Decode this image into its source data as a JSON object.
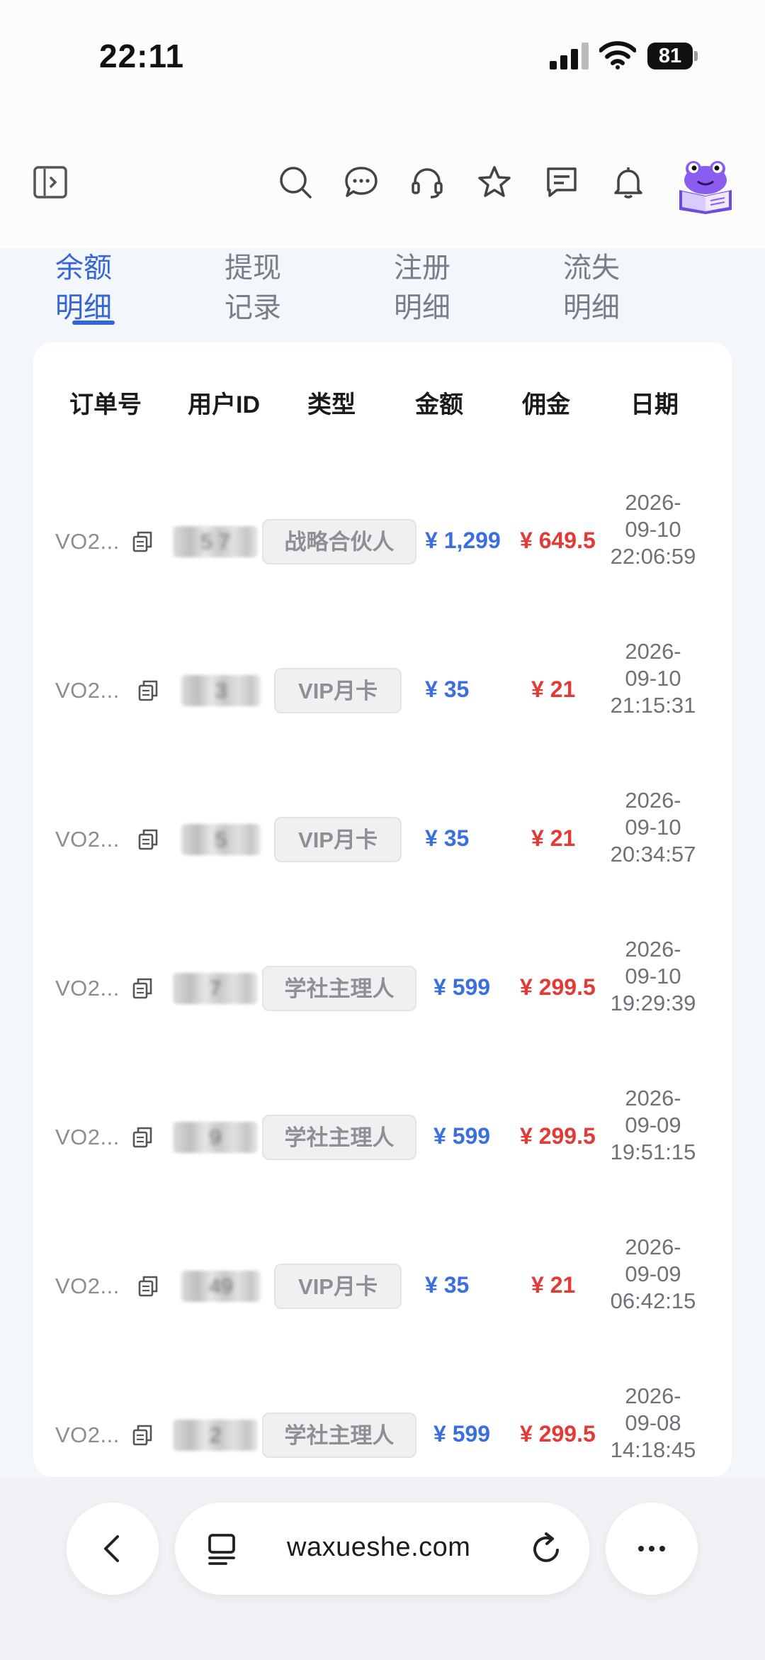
{
  "status": {
    "time": "22:11",
    "battery": "81"
  },
  "tabs": [
    {
      "line1": "余额",
      "line2": "明细",
      "active": true
    },
    {
      "line1": "提现",
      "line2": "记录",
      "active": false
    },
    {
      "line1": "注册",
      "line2": "明细",
      "active": false
    },
    {
      "line1": "流失",
      "line2": "明细",
      "active": false
    }
  ],
  "table": {
    "headers": [
      "订单号",
      "用户ID",
      "类型",
      "金额",
      "佣金",
      "日期"
    ],
    "rows": [
      {
        "order": "VO2...",
        "uid": "5 7",
        "type": "战略合伙人",
        "amount": "¥ 1,299",
        "commission": "¥ 649.5",
        "date1": "2026-",
        "date2": "09-10",
        "date3": "22:06:59"
      },
      {
        "order": "VO2...",
        "uid": "3",
        "type": "VIP月卡",
        "amount": "¥ 35",
        "commission": "¥ 21",
        "date1": "2026-",
        "date2": "09-10",
        "date3": "21:15:31"
      },
      {
        "order": "VO2...",
        "uid": "5",
        "type": "VIP月卡",
        "amount": "¥ 35",
        "commission": "¥ 21",
        "date1": "2026-",
        "date2": "09-10",
        "date3": "20:34:57"
      },
      {
        "order": "VO2...",
        "uid": "7",
        "type": "学社主理人",
        "amount": "¥ 599",
        "commission": "¥ 299.5",
        "date1": "2026-",
        "date2": "09-10",
        "date3": "19:29:39"
      },
      {
        "order": "VO2...",
        "uid": "9",
        "type": "学社主理人",
        "amount": "¥ 599",
        "commission": "¥ 299.5",
        "date1": "2026-",
        "date2": "09-09",
        "date3": "19:51:15"
      },
      {
        "order": "VO2...",
        "uid": "49",
        "type": "VIP月卡",
        "amount": "¥ 35",
        "commission": "¥ 21",
        "date1": "2026-",
        "date2": "09-09",
        "date3": "06:42:15"
      },
      {
        "order": "VO2...",
        "uid": "2",
        "type": "学社主理人",
        "amount": "¥ 599",
        "commission": "¥ 299.5",
        "date1": "2026-",
        "date2": "09-08",
        "date3": "14:18:45"
      }
    ]
  },
  "browser": {
    "url": "waxueshe.com"
  },
  "colors": {
    "accent": "#3466d6",
    "amount": "#3a6fe0",
    "commission": "#e33a36"
  },
  "icons": [
    "sidebar-toggle-icon",
    "search-icon",
    "chat-icon",
    "support-headset-icon",
    "star-icon",
    "message-icon",
    "bell-icon",
    "frog-book-avatar",
    "copy-icon",
    "back-icon",
    "tabs-icon",
    "reload-icon",
    "more-icon"
  ]
}
